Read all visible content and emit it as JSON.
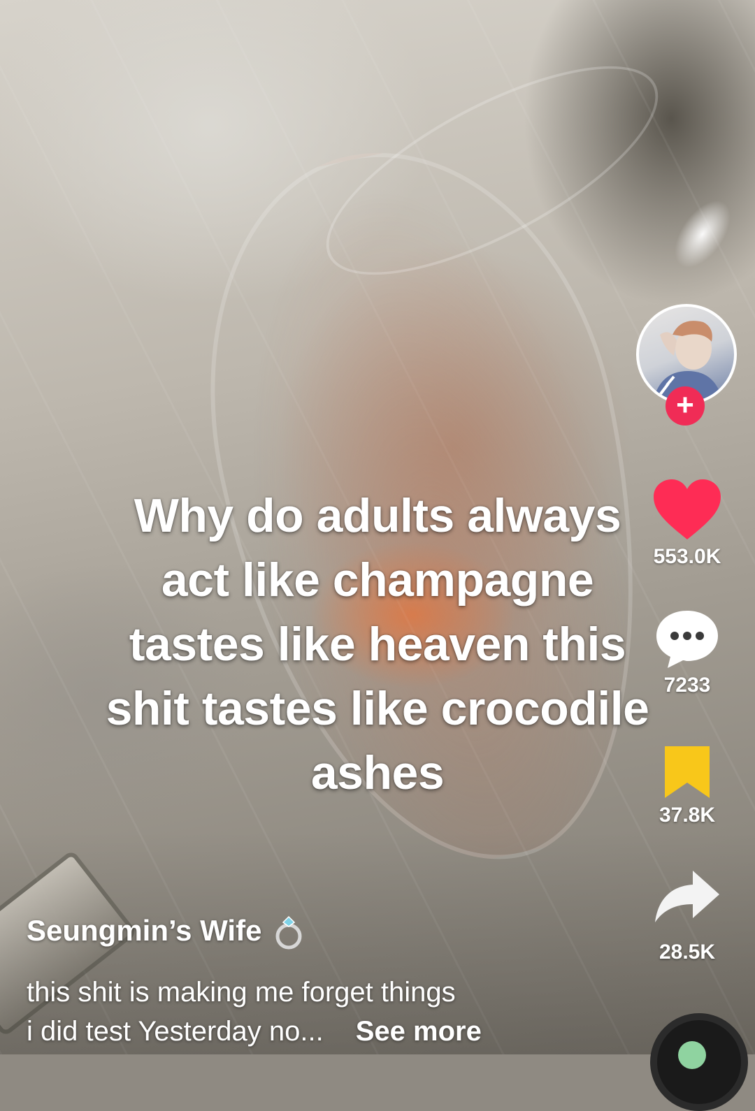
{
  "caption": {
    "lines": [
      "Why do adults always",
      "act like champagne",
      "tastes like heaven this",
      "shit tastes like crocodile",
      "ashes"
    ]
  },
  "creator": {
    "username": "Seungmin’s Wife",
    "username_icon": "ring-icon",
    "follow_label": "+"
  },
  "actions": {
    "likes": "553.0K",
    "comments": "7233",
    "saves": "37.8K",
    "shares": "28.5K"
  },
  "description": {
    "line1": "this shit is making me forget things",
    "line2": "i did test Yesterday no...",
    "see_more": "See more"
  },
  "colors": {
    "like": "#fe2c55",
    "save": "#f8c71a",
    "follow": "#f02c56"
  },
  "icons": [
    "heart-icon",
    "comment-icon",
    "bookmark-icon",
    "share-icon",
    "music-disc-icon"
  ]
}
